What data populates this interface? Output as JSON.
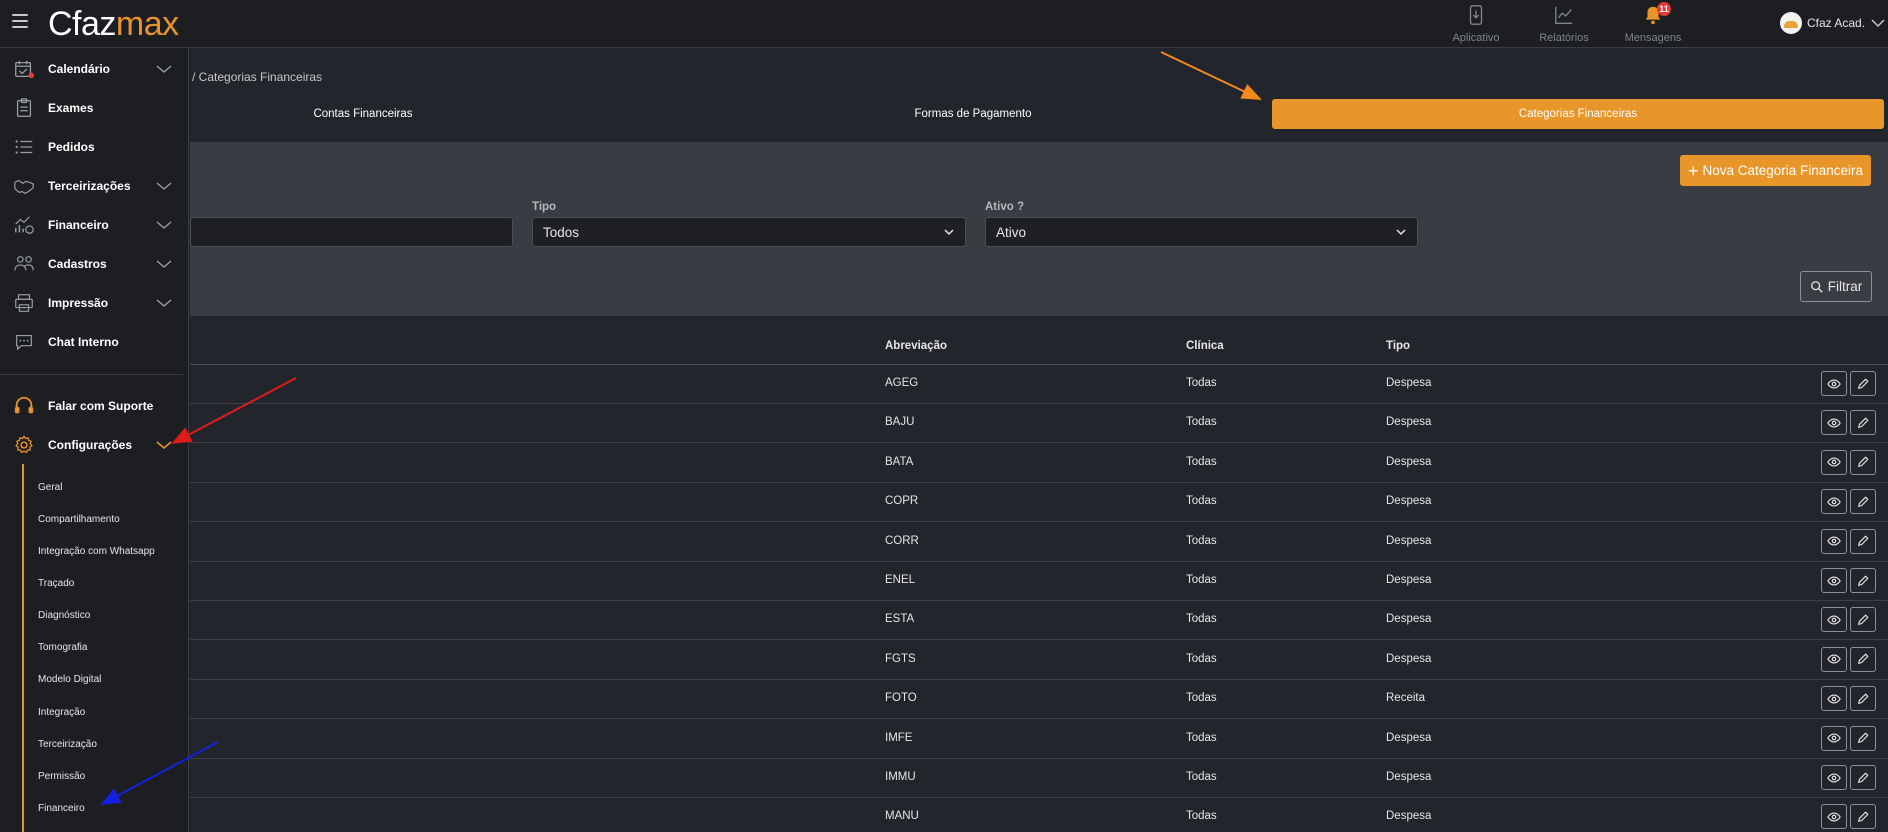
{
  "app": {
    "logo_part1": "Cfaz",
    "logo_part2": "max"
  },
  "topbar": {
    "nav": [
      {
        "label": "Aplicativo",
        "icon": "phone-download-icon"
      },
      {
        "label": "Relatórios",
        "icon": "chart-line-icon"
      },
      {
        "label": "Mensagens",
        "icon": "bell-icon",
        "badge": "11"
      }
    ],
    "user_name": "Cfaz Acad."
  },
  "sidebar": {
    "items": [
      {
        "label": "Calendário",
        "icon": "calendar-icon",
        "has_chevron": true
      },
      {
        "label": "Exames",
        "icon": "clipboard-icon",
        "has_chevron": false
      },
      {
        "label": "Pedidos",
        "icon": "list-icon",
        "has_chevron": false
      },
      {
        "label": "Terceirizações",
        "icon": "handshake-icon",
        "has_chevron": true
      },
      {
        "label": "Financeiro",
        "icon": "finance-chart-icon",
        "has_chevron": true
      },
      {
        "label": "Cadastros",
        "icon": "users-icon",
        "has_chevron": true
      },
      {
        "label": "Impressão",
        "icon": "printer-icon",
        "has_chevron": true
      },
      {
        "label": "Chat Interno",
        "icon": "chat-icon",
        "has_chevron": false
      }
    ],
    "support_label": "Falar com Suporte",
    "settings_label": "Configurações",
    "settings_submenu": [
      "Geral",
      "Compartilhamento",
      "Integração com Whatsapp",
      "Traçado",
      "Diagnóstico",
      "Tomografia",
      "Modelo Digital",
      "Integração",
      "Terceirização",
      "Permissão",
      "Financeiro"
    ]
  },
  "breadcrumb": "/  Categorias Financeiras",
  "tabs": [
    "Contas Financeiras",
    "Formas de Pagamento",
    "Categorias Financeiras"
  ],
  "active_tab": "Categorias Financeiras",
  "filters": {
    "new_button": "Nova Categoria Financeira",
    "tipo_label": "Tipo",
    "tipo_value": "Todos",
    "ativo_label": "Ativo ?",
    "ativo_value": "Ativo",
    "filter_button": "Filtrar"
  },
  "table": {
    "headers": [
      "Abreviação",
      "Clínica",
      "Tipo"
    ],
    "rows": [
      {
        "abreviacao": "AGEG",
        "clinica": "Todas",
        "tipo": "Despesa"
      },
      {
        "abreviacao": "BAJU",
        "clinica": "Todas",
        "tipo": "Despesa"
      },
      {
        "abreviacao": "BATA",
        "clinica": "Todas",
        "tipo": "Despesa"
      },
      {
        "abreviacao": "COPR",
        "clinica": "Todas",
        "tipo": "Despesa"
      },
      {
        "abreviacao": "CORR",
        "clinica": "Todas",
        "tipo": "Despesa"
      },
      {
        "abreviacao": "ENEL",
        "clinica": "Todas",
        "tipo": "Despesa"
      },
      {
        "abreviacao": "ESTA",
        "clinica": "Todas",
        "tipo": "Despesa"
      },
      {
        "abreviacao": "FGTS",
        "clinica": "Todas",
        "tipo": "Despesa"
      },
      {
        "abreviacao": "FOTO",
        "clinica": "Todas",
        "tipo": "Receita"
      },
      {
        "abreviacao": "IMFE",
        "clinica": "Todas",
        "tipo": "Despesa"
      },
      {
        "abreviacao": "IMMU",
        "clinica": "Todas",
        "tipo": "Despesa"
      },
      {
        "abreviacao": "MANU",
        "clinica": "Todas",
        "tipo": "Despesa"
      }
    ]
  },
  "colors": {
    "accent": "#e8952a",
    "bg": "#22252b",
    "panel": "#393c43",
    "arrow_orange": "#f5891f",
    "arrow_red": "#e01b1b",
    "arrow_blue": "#1520e0"
  }
}
